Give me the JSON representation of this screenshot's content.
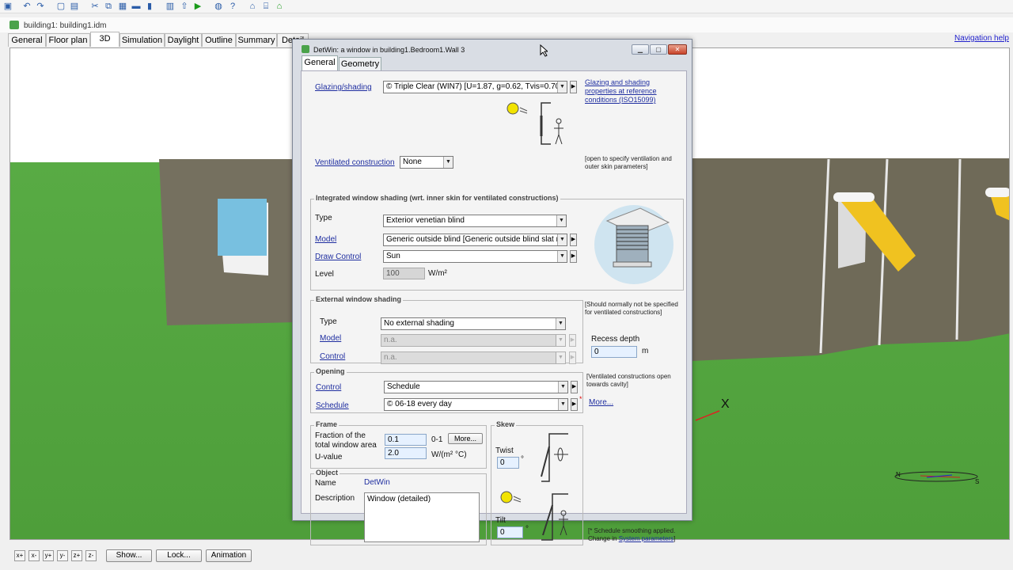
{
  "doc_title": "building1: building1.idm",
  "main_tabs": [
    "General",
    "Floor plan",
    "3D",
    "Simulation",
    "Daylight",
    "Outline",
    "Summary",
    "Detail"
  ],
  "nav_help": "Navigation help",
  "viewport": {
    "axis_label": "X",
    "compass_n": "N",
    "compass_s": "S"
  },
  "bottom": {
    "axis_buttons": [
      "x+",
      "x-",
      "y+",
      "y-",
      "z+",
      "z-"
    ],
    "show": "Show...",
    "lock": "Lock...",
    "animation": "Animation"
  },
  "dialog": {
    "title": "DetWin: a window in building1.Bedroom1.Wall 3",
    "tabs": [
      "General",
      "Geometry"
    ],
    "glazing": {
      "label": "Glazing/shading",
      "value": "© Triple Clear (WIN7) [U=1.87, g=0.62, Tvis=0.70]",
      "link": "Glazing and shading properties at reference conditions (ISO15099)"
    },
    "ventilated": {
      "label": "Ventilated construction",
      "value": "None",
      "note": "[open to specify ventilation and outer skin parameters]"
    },
    "integrated": {
      "title": "Integrated window shading (wrt. inner skin for ventilated constructions)",
      "type_label": "Type",
      "type_value": "Exterior venetian blind",
      "model_label": "Model",
      "model_value": "Generic outside blind [Generic outside blind slat m",
      "draw_label": "Draw Control",
      "draw_value": "Sun",
      "level_label": "Level",
      "level_value": "100",
      "level_unit": "W/m²"
    },
    "external": {
      "title": "External window shading",
      "type_label": "Type",
      "type_value": "No external shading",
      "model_label": "Model",
      "model_value": "n.a.",
      "control_label": "Control",
      "control_value": "n.a.",
      "note": "[Should normally not be specified for ventilated constructions]",
      "recess_label": "Recess depth",
      "recess_value": "0",
      "recess_unit": "m"
    },
    "opening": {
      "title": "Opening",
      "control_label": "Control",
      "control_value": "Schedule",
      "schedule_label": "Schedule",
      "schedule_value": "© 06-18 every day",
      "note": "[Ventilated constructions open towards cavity]",
      "more": "More..."
    },
    "frame": {
      "title": "Frame",
      "fraction_label": "Fraction of the total window area",
      "fraction_value": "0.1",
      "fraction_range": "0-1",
      "more": "More...",
      "uvalue_label": "U-value",
      "uvalue_value": "2.0",
      "uvalue_unit": "W/(m² °C)"
    },
    "skew": {
      "title": "Skew",
      "twist_label": "Twist",
      "twist_value": "0",
      "tilt_label": "Tilt",
      "tilt_value": "0",
      "deg": "°"
    },
    "object": {
      "title": "Object",
      "name_label": "Name",
      "name_value": "DetWin",
      "desc_label": "Description",
      "desc_value": "Window (detailed)"
    },
    "footnote_prefix": "[* Schedule smoothing applied. Change in",
    "footnote_link": "System parameters",
    "footnote_suffix": "]"
  }
}
